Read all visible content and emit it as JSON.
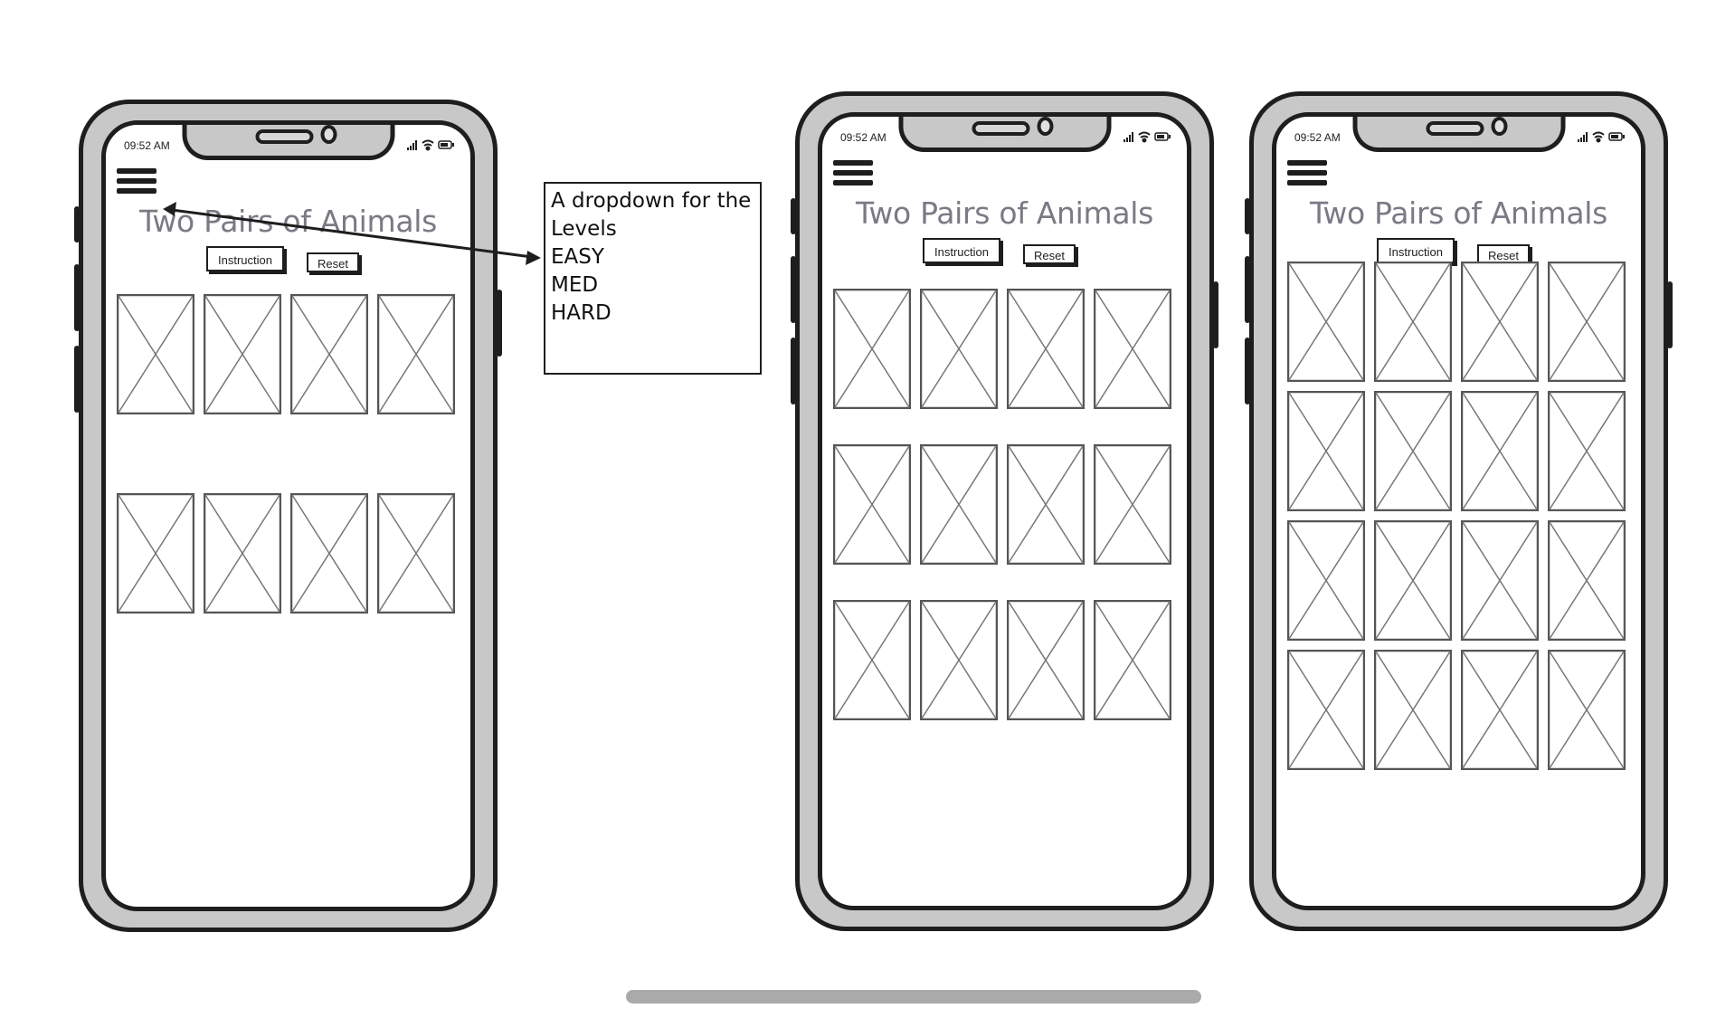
{
  "phones": [
    {
      "id": "phone-1",
      "time": "09:52 AM",
      "title": "Two Pairs of Animals",
      "instruction_label": "Instruction",
      "reset_label": "Reset",
      "grid_rows": 2,
      "grid_cols": 4
    },
    {
      "id": "phone-2",
      "time": "09:52 AM",
      "title": "Two Pairs of Animals",
      "instruction_label": "Instruction",
      "reset_label": "Reset",
      "grid_rows": 3,
      "grid_cols": 4
    },
    {
      "id": "phone-3",
      "time": "09:52 AM",
      "title": "Two Pairs of Animals",
      "instruction_label": "Instruction",
      "reset_label": "Reset",
      "grid_rows": 4,
      "grid_cols": 4
    }
  ],
  "annotation": {
    "lines": [
      "A dropdown for the",
      "Levels",
      "EASY",
      "MED",
      "HARD"
    ]
  },
  "colors": {
    "frame": "#c8c8c8",
    "outline": "#1e1e1e",
    "title": "#7a7a86",
    "scrollbar": "#aaaaaa"
  },
  "icons": [
    "hamburger-menu-icon",
    "signal-icon",
    "wifi-icon",
    "battery-icon",
    "image-placeholder-icon",
    "arrow-icon"
  ]
}
